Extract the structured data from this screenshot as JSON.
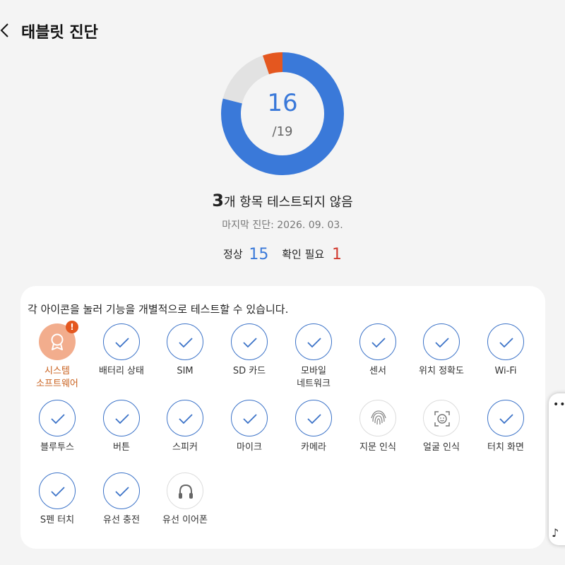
{
  "header": {
    "title": "태블릿 진단"
  },
  "progress": {
    "passed": "16",
    "total": "/19"
  },
  "summary": {
    "count": "3",
    "text": "개 항목 테스트되지 않음",
    "last_diagnosis": "마지막 진단: 2026. 09. 03."
  },
  "counts": {
    "normal_label": "정상",
    "normal_value": "15",
    "check_label": "확인 필요",
    "check_value": "1"
  },
  "card": {
    "hint": "각 아이콘을 눌러 기능을 개별적으로 테스트할 수 있습니다.",
    "tests": [
      {
        "label": "시스템\n소프트웨어",
        "status": "attention",
        "icon": "award-icon"
      },
      {
        "label": "배터리 상태",
        "status": "passed",
        "icon": "check-icon"
      },
      {
        "label": "SIM",
        "status": "passed",
        "icon": "check-icon"
      },
      {
        "label": "SD 카드",
        "status": "passed",
        "icon": "check-icon"
      },
      {
        "label": "모바일\n네트워크",
        "status": "passed",
        "icon": "check-icon"
      },
      {
        "label": "센서",
        "status": "passed",
        "icon": "check-icon"
      },
      {
        "label": "위치 정확도",
        "status": "passed",
        "icon": "check-icon"
      },
      {
        "label": "Wi-Fi",
        "status": "passed",
        "icon": "check-icon"
      },
      {
        "label": "블루투스",
        "status": "passed",
        "icon": "check-icon"
      },
      {
        "label": "버튼",
        "status": "passed",
        "icon": "check-icon"
      },
      {
        "label": "스피커",
        "status": "passed",
        "icon": "check-icon"
      },
      {
        "label": "마이크",
        "status": "passed",
        "icon": "check-icon"
      },
      {
        "label": "카메라",
        "status": "passed",
        "icon": "check-icon"
      },
      {
        "label": "지문 인식",
        "status": "untested",
        "icon": "fingerprint-icon"
      },
      {
        "label": "얼굴 인식",
        "status": "untested",
        "icon": "face-scan-icon"
      },
      {
        "label": "터치 화면",
        "status": "passed",
        "icon": "check-icon"
      },
      {
        "label": "S펜 터치",
        "status": "passed",
        "icon": "check-icon"
      },
      {
        "label": "유선 충전",
        "status": "passed",
        "icon": "check-icon"
      },
      {
        "label": "유선 이어폰",
        "status": "untested",
        "icon": "headphones-icon"
      }
    ]
  },
  "colors": {
    "passed": "#3a79d9",
    "attention": "#e4571f",
    "untested": "#e2e2e2"
  },
  "edge_panel": {
    "dots": "•••",
    "note": "♪"
  }
}
